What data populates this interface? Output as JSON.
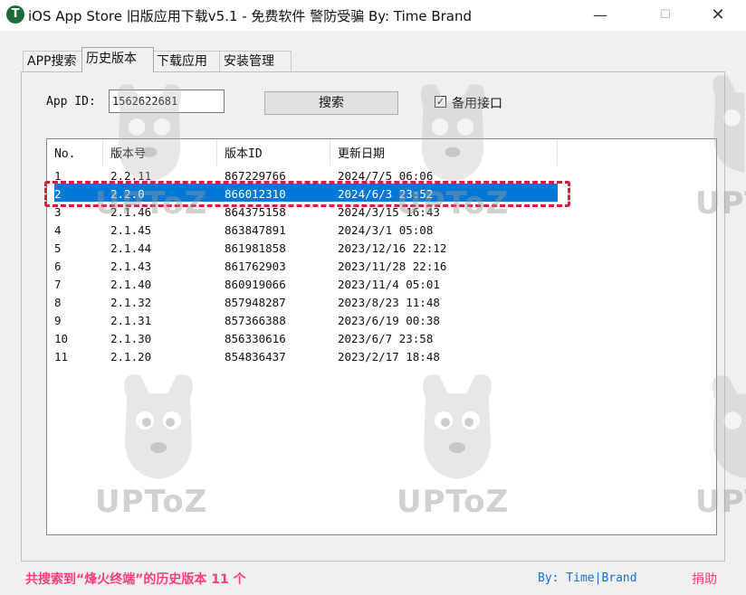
{
  "window": {
    "title": "iOS App Store 旧版应用下载v5.1 - 免费软件 警防受骗 By: Time Brand",
    "icon_letter": "T",
    "min_glyph": "—",
    "max_glyph": "☐",
    "close_glyph": "✕"
  },
  "tabs": [
    {
      "label": "APP搜索"
    },
    {
      "label": "历史版本"
    },
    {
      "label": "下载应用"
    },
    {
      "label": "安装管理"
    }
  ],
  "form": {
    "appid_label": "App ID:",
    "appid_value": "1562622681",
    "search_button": "搜索",
    "backup_checked": "✓",
    "backup_label": "备用接口"
  },
  "table": {
    "columns": [
      "No.",
      "版本号",
      "版本ID",
      "更新日期"
    ],
    "rows": [
      {
        "no": "1",
        "version": "2.2.11",
        "version_id": "867229766",
        "date": "2024/7/5 06:06"
      },
      {
        "no": "2",
        "version": "2.2.0",
        "version_id": "866012310",
        "date": "2024/6/3 23:52"
      },
      {
        "no": "3",
        "version": "2.1.46",
        "version_id": "864375158",
        "date": "2024/3/15 16:43"
      },
      {
        "no": "4",
        "version": "2.1.45",
        "version_id": "863847891",
        "date": "2024/3/1 05:08"
      },
      {
        "no": "5",
        "version": "2.1.44",
        "version_id": "861981858",
        "date": "2023/12/16 22:12"
      },
      {
        "no": "6",
        "version": "2.1.43",
        "version_id": "861762903",
        "date": "2023/11/28 22:16"
      },
      {
        "no": "7",
        "version": "2.1.40",
        "version_id": "860919066",
        "date": "2023/11/4 05:01"
      },
      {
        "no": "8",
        "version": "2.1.32",
        "version_id": "857948287",
        "date": "2023/8/23 11:48"
      },
      {
        "no": "9",
        "version": "2.1.31",
        "version_id": "857366388",
        "date": "2023/6/19 00:38"
      },
      {
        "no": "10",
        "version": "2.1.30",
        "version_id": "856330616",
        "date": "2023/6/7 23:58"
      },
      {
        "no": "11",
        "version": "2.1.20",
        "version_id": "854836437",
        "date": "2023/2/17 18:48"
      }
    ],
    "selected_row": 2
  },
  "status": {
    "result_text": "共搜索到“烽火终端”的历史版本 11 个",
    "by_text": "By: Time|Brand",
    "donate": "捐助"
  },
  "watermark": {
    "text": "UPToZ"
  },
  "colors": {
    "selection": "#0078d7",
    "highlight_border": "#d0213a",
    "status_pink": "#ff3d7a",
    "status_blue": "#1a6fd8"
  }
}
